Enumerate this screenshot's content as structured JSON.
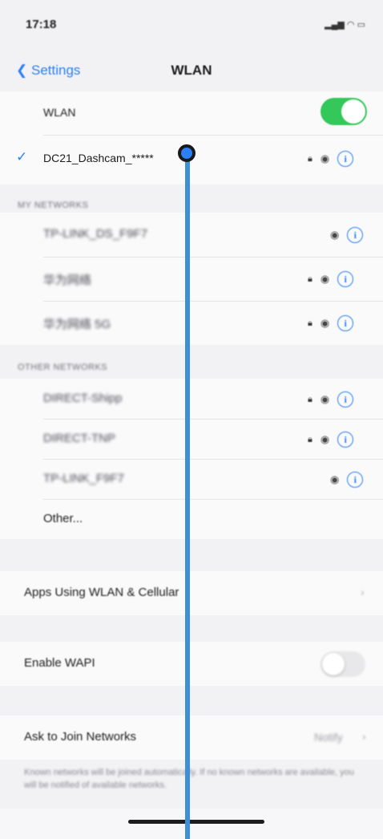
{
  "status_bar": {
    "time": "17:18",
    "icons": "signal wifi battery"
  },
  "nav": {
    "back_label": "Settings",
    "title": "WLAN"
  },
  "wlan_row": {
    "label": "WLAN",
    "enabled": true
  },
  "connected_network": {
    "name": "DC21_Dashcam_*****"
  },
  "my_networks": {
    "header": "MY NETWORKS",
    "items": [
      {
        "name": "TP-LINK_DS_F9F7",
        "locked": false
      },
      {
        "name": "华为网络",
        "locked": true
      },
      {
        "name": "华为网络 5G",
        "locked": true
      }
    ]
  },
  "other_networks": {
    "header": "OTHER NETWORKS",
    "items": [
      {
        "name": "DIRECT-Shipp",
        "locked": true
      },
      {
        "name": "DIRECT-TNP",
        "locked": true
      },
      {
        "name": "TP-LINK_F9F7",
        "locked": false
      }
    ],
    "other_label": "Other..."
  },
  "apps_row": {
    "label": "Apps Using WLAN & Cellular"
  },
  "wapi_row": {
    "label": "Enable WAPI",
    "enabled": false
  },
  "ask_join": {
    "label": "Ask to Join Networks",
    "value": "Notify",
    "footer": "Known networks will be joined automatically. If no known networks are available, you will be notified of available networks."
  },
  "colors": {
    "accent": "#2d7ff5",
    "toggle_on": "#34c759",
    "overlay_line": "#3e8fd6"
  }
}
